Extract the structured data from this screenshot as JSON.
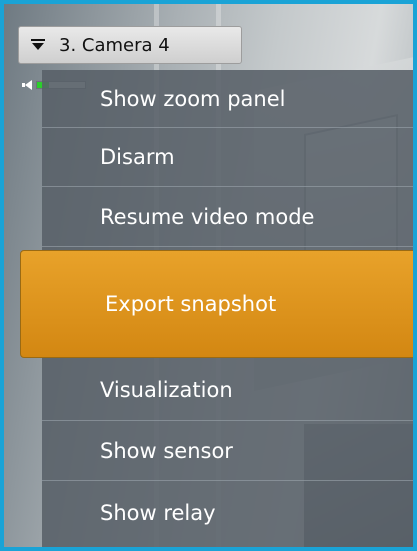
{
  "camera": {
    "title": "3. Camera 4"
  },
  "volume": {
    "level": 0.25
  },
  "context_menu": {
    "items": [
      {
        "label": "Show zoom panel",
        "highlighted": false
      },
      {
        "label": "Disarm",
        "highlighted": false
      },
      {
        "label": "Resume video mode",
        "highlighted": false
      },
      {
        "label": "Export snapshot",
        "highlighted": true
      },
      {
        "label": "Visualization",
        "highlighted": false
      },
      {
        "label": "Show sensor",
        "highlighted": false
      },
      {
        "label": "Show relay",
        "highlighted": false
      }
    ]
  },
  "colors": {
    "frame_border": "#1aa3d6",
    "highlight": "#e39622",
    "menu_background": "#58606a"
  },
  "icons": [
    "menu-triangle-icon",
    "speaker-icon"
  ]
}
